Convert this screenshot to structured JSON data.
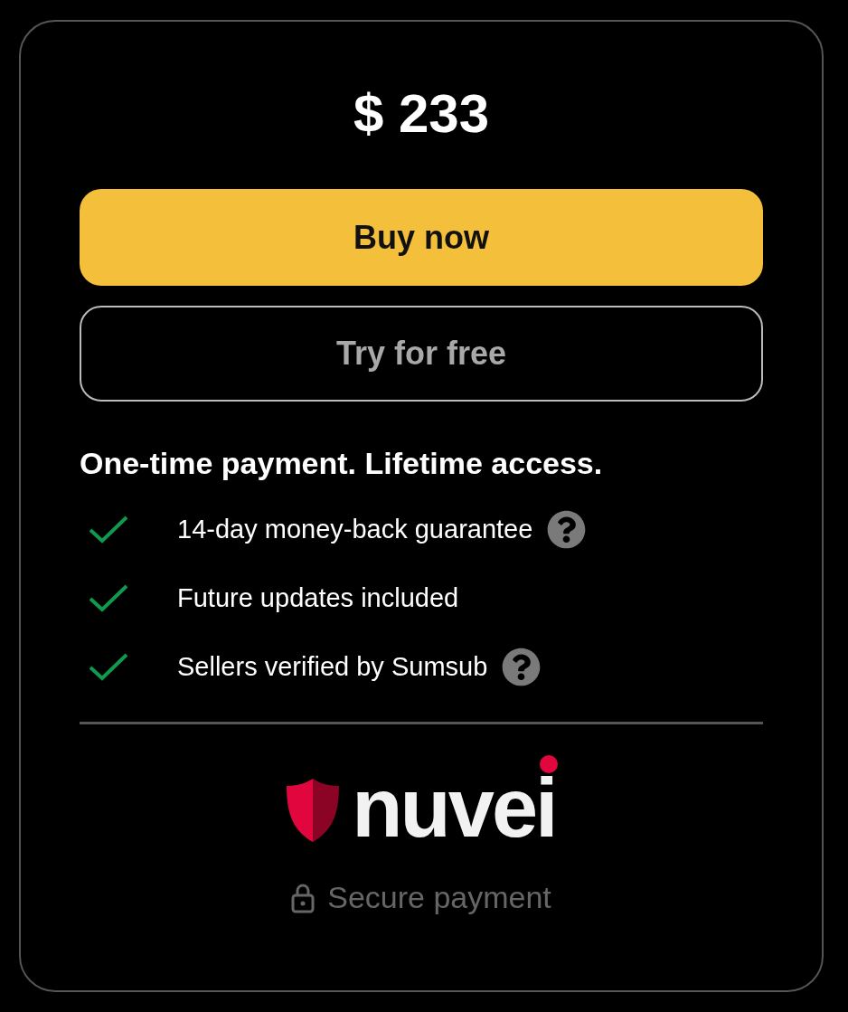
{
  "price": "$ 233",
  "buttons": [
    {
      "kind": "primary",
      "label": "Buy now"
    },
    {
      "kind": "outline",
      "label": "Try for free"
    }
  ],
  "headline": "One-time payment. Lifetime access.",
  "features": [
    {
      "text": "14-day money-back guarantee",
      "help": true
    },
    {
      "text": "Future updates included",
      "help": false
    },
    {
      "text": "Sellers verified by Sumsub",
      "help": true
    }
  ],
  "brand": "nuvei",
  "secure_note": "Secure payment"
}
